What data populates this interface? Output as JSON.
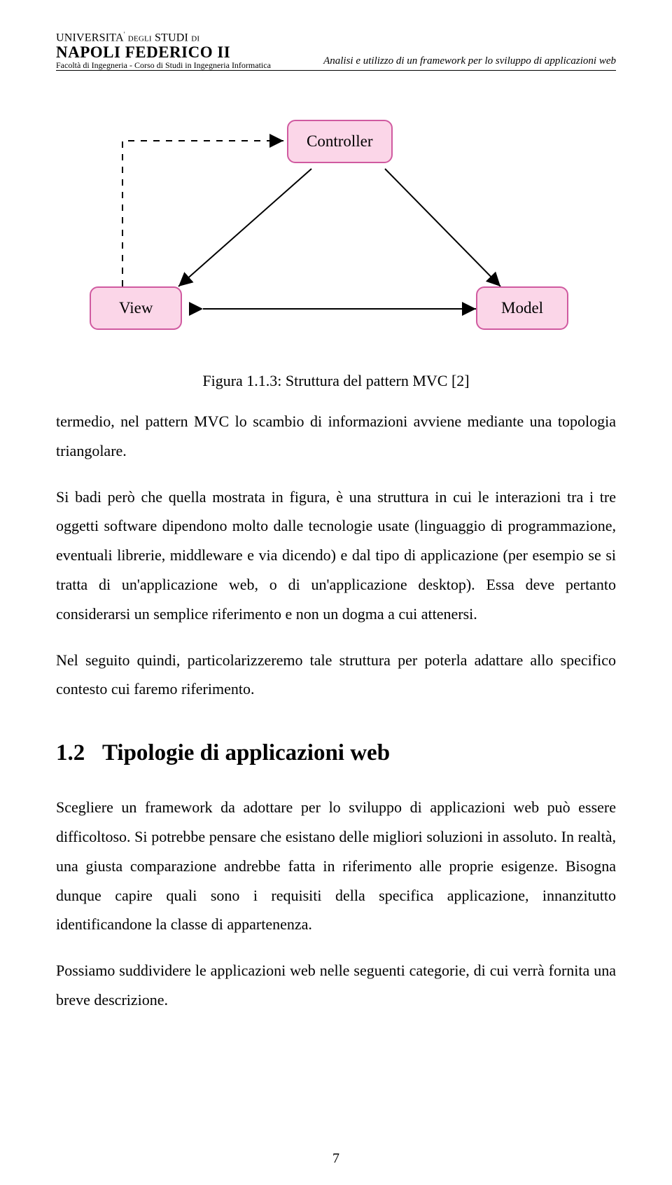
{
  "header": {
    "uni_line1_a": "UNIVERSITA",
    "uni_line1_sup": "'",
    "uni_line1_b": "DEGLI",
    "uni_line1_c": "STUDI",
    "uni_line1_d": "DI",
    "uni_line2": "NAPOLI FEDERICO II",
    "uni_line3": "Facoltà di Ingegneria - Corso di Studi in Ingegneria Informatica",
    "right": "Analisi e utilizzo di un framework per lo sviluppo di applicazioni web"
  },
  "diagram": {
    "controller": "Controller",
    "view": "View",
    "model": "Model"
  },
  "caption": "Figura 1.1.3: Struttura del pattern MVC [2]",
  "para1": "termedio, nel pattern MVC lo scambio di informazioni avviene mediante una topologia triangolare.",
  "para2": "Si badi però che quella mostrata in figura, è una struttura in cui le interazioni tra i tre oggetti software dipendono molto dalle tecnologie usate (linguaggio di programmazione, eventuali librerie, middleware e via dicendo) e dal tipo di applicazione (per esempio se si tratta di un'applicazione web, o di un'applicazione desktop). Essa deve pertanto considerarsi un semplice riferimento e non un dogma a cui attenersi.",
  "para3": "Nel seguito quindi, particolarizzeremo tale struttura per poterla adattare allo specifico contesto cui faremo riferimento.",
  "section_number": "1.2",
  "section_title": "Tipologie di applicazioni web",
  "para4": "Scegliere un framework da adottare per lo sviluppo di applicazioni web può essere difficoltoso. Si potrebbe pensare che esistano delle migliori soluzioni in assoluto. In realtà, una giusta comparazione andrebbe fatta in riferimento alle proprie esigenze. Bisogna dunque capire quali sono i requisiti della specifica applicazione, innanzitutto identificandone la classe di appartenenza.",
  "para5": "Possiamo suddividere le applicazioni web nelle seguenti categorie, di cui verrà fornita una breve descrizione.",
  "pagenum": "7"
}
